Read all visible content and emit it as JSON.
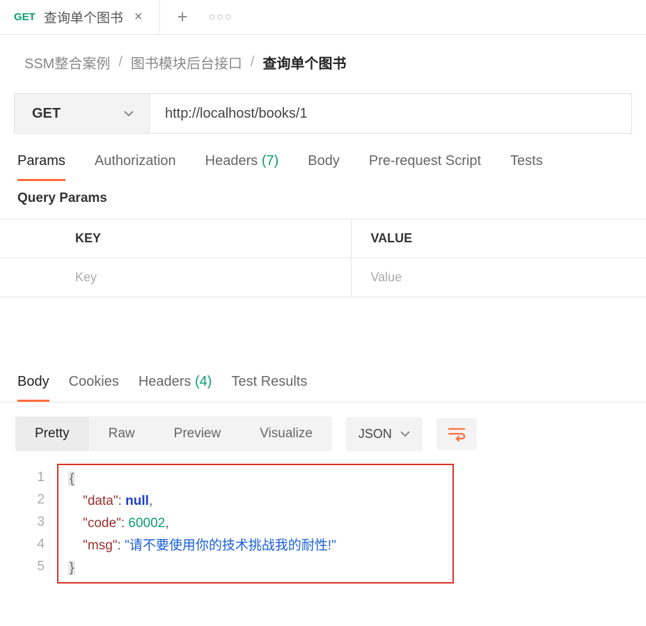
{
  "tab": {
    "method": "GET",
    "title": "查询单个图书"
  },
  "breadcrumb": {
    "items": [
      "SSM整合案例",
      "图书模块后台接口"
    ],
    "current": "查询单个图书",
    "sep": "/"
  },
  "request": {
    "method": "GET",
    "url": "http://localhost/books/1"
  },
  "reqTabs": {
    "params": "Params",
    "auth": "Authorization",
    "headers_prefix": "Headers ",
    "headers_count": "(7)",
    "body": "Body",
    "prereq": "Pre-request Script",
    "tests": "Tests"
  },
  "paramsSection": {
    "label": "Query Params",
    "keyHeader": "KEY",
    "valueHeader": "VALUE",
    "keyPlaceholder": "Key",
    "valuePlaceholder": "Value"
  },
  "respTabs": {
    "body": "Body",
    "cookies": "Cookies",
    "headers_prefix": "Headers ",
    "headers_count": "(4)",
    "tests": "Test Results"
  },
  "viewTabs": {
    "pretty": "Pretty",
    "raw": "Raw",
    "preview": "Preview",
    "visualize": "Visualize"
  },
  "format": "JSON",
  "lineNumbers": [
    "1",
    "2",
    "3",
    "4",
    "5"
  ],
  "json": {
    "open": "{",
    "k1": "\"data\"",
    "v1": "null",
    "k2": "\"code\"",
    "v2": "60002",
    "k3": "\"msg\"",
    "v3": "\"请不要使用你的技术挑战我的耐性!\"",
    "colon": ": ",
    "comma": ",",
    "close": "}"
  }
}
